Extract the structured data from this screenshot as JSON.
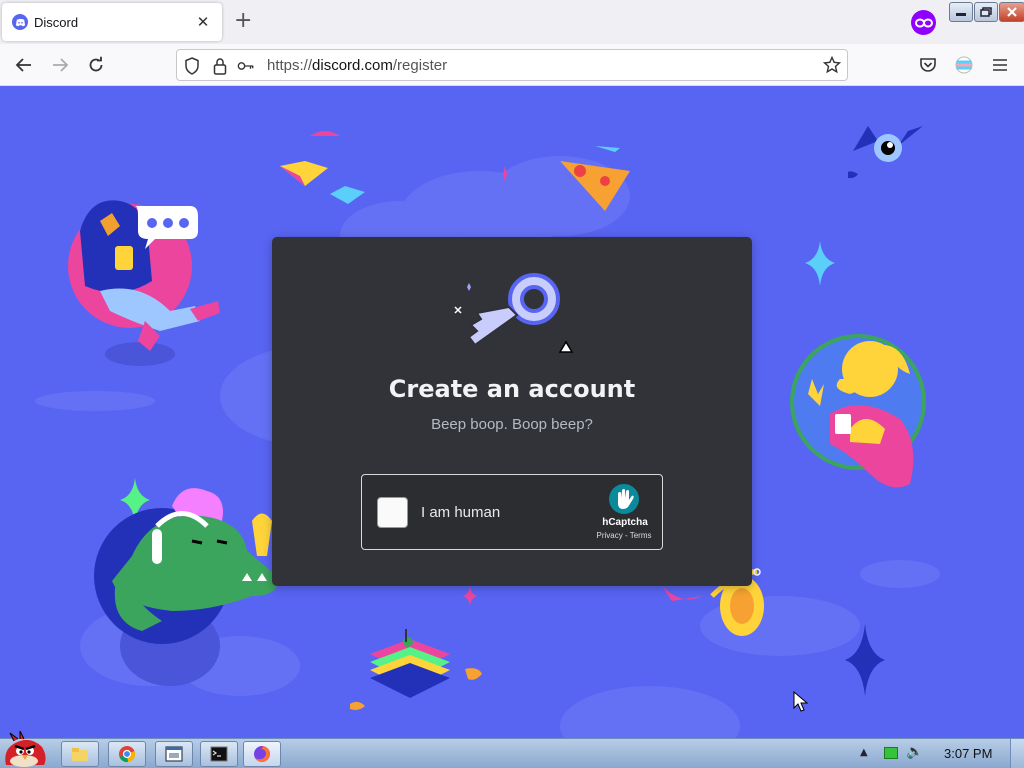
{
  "browser": {
    "tab_title": "Discord",
    "tab_close": "✕",
    "new_tab": "+",
    "url_prefix": "https://",
    "url_domain": "discord.com",
    "url_path": "/register"
  },
  "modal": {
    "title": "Create an account",
    "subtitle": "Beep boop. Boop beep?"
  },
  "captcha": {
    "label": "I am human",
    "brand": "hCaptcha",
    "links": "Privacy - Terms"
  },
  "taskbar": {
    "clock": "3:07 PM"
  },
  "colors": {
    "discord_blurple": "#5865f2",
    "modal_bg": "#313338",
    "private_purple": "#8f00ff"
  },
  "icons": [
    "discord-favicon-icon",
    "back-icon",
    "forward-icon",
    "reload-icon",
    "shield-icon",
    "lock-icon",
    "key-icon",
    "star-icon",
    "pocket-icon",
    "extension-icon",
    "menu-icon",
    "private-browsing-icon"
  ]
}
